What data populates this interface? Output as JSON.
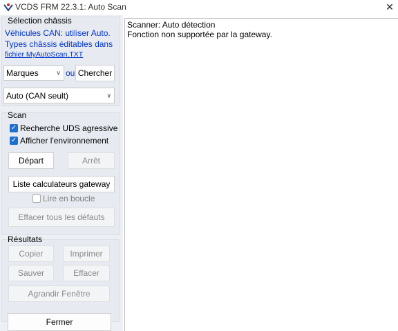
{
  "window": {
    "title": "VCDS FRM 22.3.1:  Auto Scan",
    "close_glyph": "✕",
    "icon": "vcds-app-icon"
  },
  "chassis": {
    "group_title": "Sélection châssis",
    "line1": "Véhicules CAN: utiliser Auto.",
    "line2": "Types châssis éditables dans",
    "link": "fichier MyAutoScan.TXT",
    "brands_select": "Marques",
    "or_label": "ou",
    "search_button": "Chercher",
    "type_select": "Auto (CAN seult)"
  },
  "scan": {
    "group_title": "Scan",
    "aggressive_uds": {
      "label": "Recherche UDS agressive",
      "checked": true
    },
    "show_env": {
      "label": "Afficher l'environnement",
      "checked": true
    },
    "start_button": "Départ",
    "stop_button": "Arrêt",
    "gateway_list_button": "Liste calculateurs gateway",
    "loop_read": {
      "label": "Lire en boucle",
      "checked": false
    },
    "clear_all_button": "Effacer tous les défauts"
  },
  "results": {
    "group_title": "Résultats",
    "copy_button": "Copier",
    "print_button": "Imprimer",
    "save_button": "Sauver",
    "clear_button": "Effacer",
    "enlarge_button": "Agrandir Fenêtre"
  },
  "close_button": "Fermer",
  "output": {
    "lines": [
      "Scanner: Auto détection",
      "Fonction non supportée par la gateway."
    ]
  }
}
